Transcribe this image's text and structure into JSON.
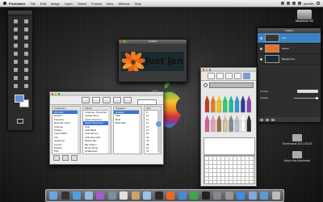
{
  "menubar": {
    "app_name": "Pixelmator",
    "items": [
      "File",
      "Edit",
      "Image",
      "Layer",
      "Select",
      "Format",
      "View",
      "Window",
      "Help"
    ],
    "user": "jennifer"
  },
  "hd_icon": {
    "label": "Macintosh HD"
  },
  "image_window": {
    "title": "Untitled",
    "artwork_text": "Just Jen"
  },
  "layers_panel": {
    "title": "Layers",
    "rows": [
      {
        "name": "Text"
      },
      {
        "name": "Flower"
      },
      {
        "name": "Background"
      }
    ],
    "blend_label": "Normal",
    "opacity_label": "Opacity"
  },
  "font_panel": {
    "columns": [
      {
        "header": "Collections",
        "items": [
          "All Fonts",
          "English",
          "Favorites",
          "Recently Used",
          "Chinese",
          "Classic",
          "Fixed Width",
          "Fun",
          "Japanese",
          "Korean",
          "Modern",
          "PDF",
          "Traditional",
          "Web"
        ],
        "selected": 0
      },
      {
        "header": "Family",
        "items": [
          "American Typewriter",
          "Andale Mono",
          "Apple Chancery",
          "Apple Garamond",
          "Arial",
          "Arial Black",
          "Arial Narrow",
          "Arial Rounded",
          "Baskerville",
          "Big Caslon",
          "Brush Script",
          "Chalkboard",
          "Cochin",
          "Comic Sans"
        ],
        "selected": 3
      },
      {
        "header": "Typeface",
        "items": [
          "Regular",
          "Italic",
          "Bold",
          "Bold Italic"
        ],
        "selected": 0
      },
      {
        "header": "Size",
        "items": [
          "9",
          "10",
          "11",
          "12",
          "13",
          "14",
          "18",
          "24",
          "36",
          "48",
          "64",
          "72"
        ],
        "selected": -1
      }
    ]
  },
  "desktop_items": [
    {
      "label": "Screenshot 2011-03-03"
    },
    {
      "label": "About this Macintosh"
    }
  ],
  "colors": {
    "accent": "#3875d7",
    "crayons": [
      "#c0392b",
      "#e67e22",
      "#f1c40f",
      "#2ecc71",
      "#1abc9c",
      "#3498db",
      "#2c3e90",
      "#8e44ad",
      "#d35b9a",
      "#e8a0b4",
      "#9b6b43",
      "#d8c39a",
      "#7f8c8d",
      "#bdc3c7",
      "#ffffff",
      "#2c2c2c"
    ]
  },
  "dock_icons": [
    "finder-icon",
    "dashboard-icon",
    "safari-icon",
    "mail-icon",
    "itunes-icon",
    "photo-icon",
    "calendar-icon",
    "contacts-icon",
    "preview-icon",
    "pixelmator-icon",
    "firefox-icon",
    "iwork-icon",
    "chat-icon",
    "terminal-icon",
    "settings-icon",
    "system-prefs-icon",
    "app-store-icon",
    "folder-icon",
    "downloads-icon",
    "trash-icon"
  ]
}
